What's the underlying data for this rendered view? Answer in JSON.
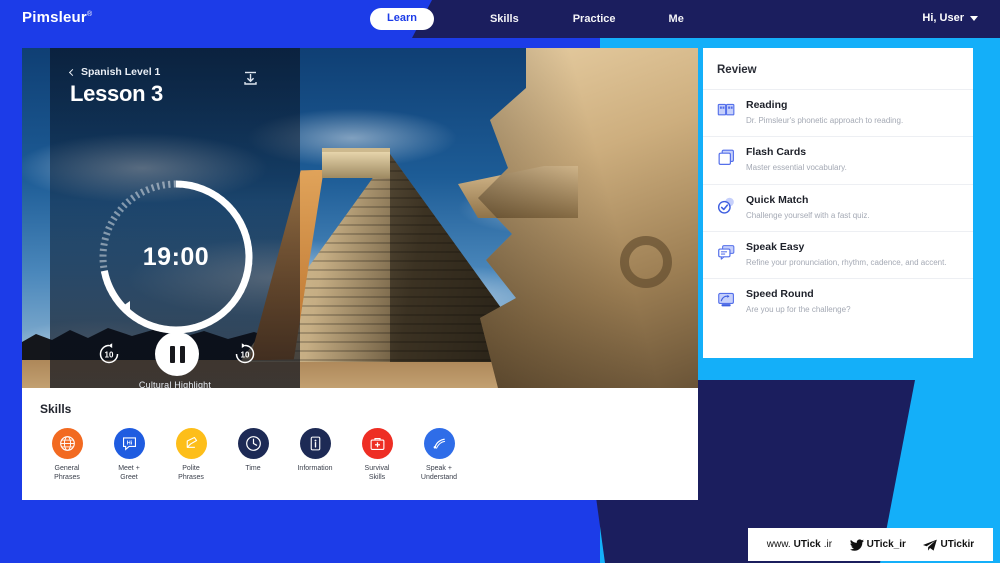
{
  "brand": {
    "name": "Pimsleur",
    "registered": "®"
  },
  "nav": {
    "active_tab": "Learn",
    "tabs": [
      "Skills",
      "Practice",
      "Me"
    ],
    "user_label": "Hi, User"
  },
  "lesson": {
    "breadcrumb": "Spanish Level 1",
    "title": "Lesson 3",
    "timer": "19:00",
    "progress_percent": 72,
    "download_icon": "download-icon",
    "controls": {
      "rewind_label": "10",
      "forward_label": "10",
      "play_state": "pause"
    },
    "caption": "Cultural Highlight",
    "slides": 2,
    "active_slide": 1
  },
  "skills": {
    "title": "Skills",
    "items": [
      {
        "label": "General\nPhrases",
        "color": "#f26a21",
        "icon": "globe-icon"
      },
      {
        "label": "Meet +\nGreet",
        "color": "#1f5ce0",
        "icon": "speech-bubble-icon"
      },
      {
        "label": "Polite\nPhrases",
        "color": "#fdbe1a",
        "icon": "hand-wave-icon"
      },
      {
        "label": "Time",
        "color": "#1d2a55",
        "icon": "clock-icon"
      },
      {
        "label": "Information",
        "color": "#1d2a55",
        "icon": "info-board-icon"
      },
      {
        "label": "Survival\nSkills",
        "color": "#ee2e24",
        "icon": "first-aid-kit-icon"
      },
      {
        "label": "Speak +\nUnderstand",
        "color": "#2f6de8",
        "icon": "sound-wave-icon"
      }
    ]
  },
  "review": {
    "title": "Review",
    "items": [
      {
        "name": "Reading",
        "desc": "Dr. Pimsleur's phonetic approach to reading.",
        "icon": "book-icon"
      },
      {
        "name": "Flash Cards",
        "desc": "Master essential vocabulary.",
        "icon": "cards-icon"
      },
      {
        "name": "Quick Match",
        "desc": "Challenge yourself with a fast quiz.",
        "icon": "check-circle-icon"
      },
      {
        "name": "Speak Easy",
        "desc": "Refine your pronunciation, rhythm, cadence, and accent.",
        "icon": "chat-icon"
      },
      {
        "name": "Speed Round",
        "desc": "Are you up for the challenge?",
        "icon": "speed-screen-icon"
      }
    ]
  },
  "watermark": {
    "site": "www.UTick.ir",
    "twitter": "UTick_ir",
    "telegram": "UTickir"
  },
  "colors": {
    "brand_blue": "#1c3ce8",
    "navy": "#1b1e5e",
    "cyan": "#14aff9",
    "accent_white": "#ffffff"
  }
}
